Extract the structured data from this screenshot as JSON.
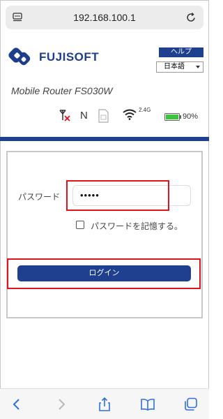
{
  "browser": {
    "url": "192.168.100.1"
  },
  "header": {
    "brand": "FUJISOFT",
    "help_label": "ヘルプ",
    "language": "日本語",
    "model": "Mobile Router FS030W"
  },
  "status": {
    "network_mode": "N",
    "wifi_band": "2.4G",
    "battery": "90%"
  },
  "login": {
    "password_label": "パスワード",
    "password_value": "•••••",
    "remember_label": "パスワードを記憶する。",
    "remember_checked": false,
    "login_button": "ログイン"
  },
  "colors": {
    "brand_blue": "#1f3f8f",
    "highlight_red": "#e0141e",
    "battery_green": "#3cc43c"
  }
}
